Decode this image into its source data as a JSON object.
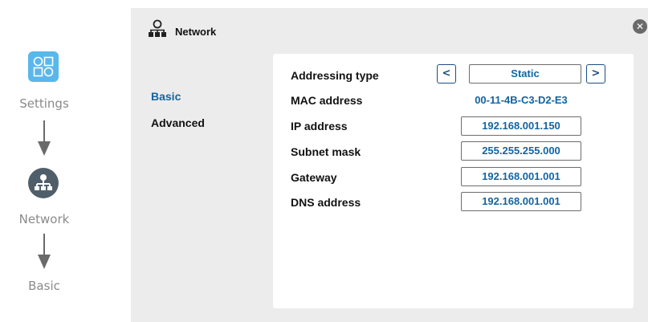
{
  "flow": {
    "steps": [
      {
        "label": "Settings",
        "icon": "settings-grid-icon"
      },
      {
        "label": "Network",
        "icon": "network-icon"
      },
      {
        "label": "Basic"
      }
    ]
  },
  "panel": {
    "title": "Network",
    "title_icon": "network-icon",
    "close_icon": "close-icon"
  },
  "nav": {
    "items": [
      {
        "label": "Basic",
        "selected": true
      },
      {
        "label": "Advanced",
        "selected": false
      }
    ]
  },
  "form": {
    "addressing_type": {
      "label": "Addressing type",
      "value": "Static",
      "prev": "<",
      "next": ">"
    },
    "mac": {
      "label": "MAC address",
      "value": "00-11-4B-C3-D2-E3"
    },
    "ip": {
      "label": "IP address",
      "value": "192.168.001.150"
    },
    "subnet": {
      "label": "Subnet mask",
      "value": "255.255.255.000"
    },
    "gateway": {
      "label": "Gateway",
      "value": "192.168.001.001"
    },
    "dns": {
      "label": "DNS address",
      "value": "192.168.001.001"
    }
  },
  "colors": {
    "accent": "#1464a0",
    "settings_icon_bg": "#5ab7ec",
    "network_icon_bg": "#505e69",
    "panel_bg": "#ececec"
  }
}
